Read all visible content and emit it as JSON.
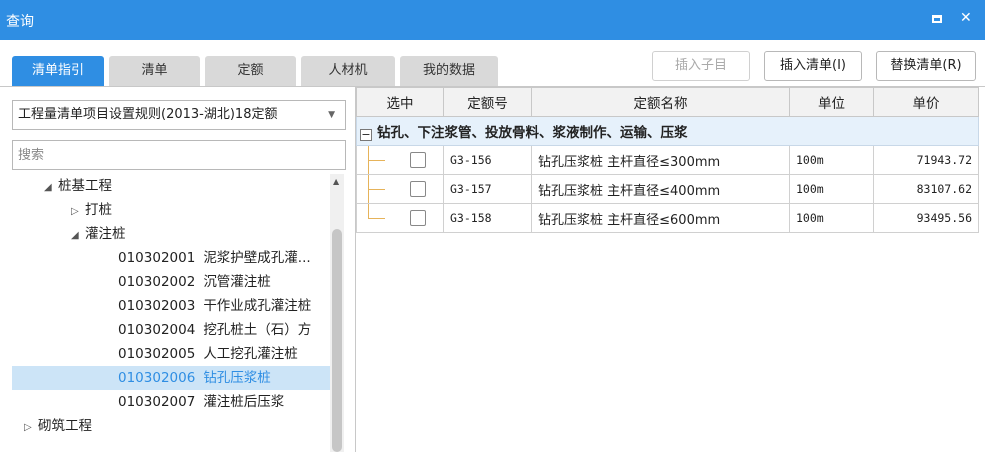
{
  "window": {
    "title": "查询"
  },
  "tabs": [
    {
      "label": "清单指引",
      "active": true
    },
    {
      "label": "清单",
      "active": false
    },
    {
      "label": "定额",
      "active": false
    },
    {
      "label": "人材机",
      "active": false
    },
    {
      "label": "我的数据",
      "active": false
    }
  ],
  "toolbar": {
    "insert_child": "插入子目",
    "insert_list": "插入清单(I)",
    "replace_list": "替换清单(R)"
  },
  "library": {
    "selected": "工程量清单项目设置规则(2013-湖北)18定额"
  },
  "search": {
    "placeholder": "搜索",
    "value": ""
  },
  "tree": [
    {
      "twisty": "◢",
      "code": "",
      "label": "桩基工程"
    },
    {
      "twisty": "▷",
      "code": "",
      "label": "打桩"
    },
    {
      "twisty": "◢",
      "code": "",
      "label": "灌注桩"
    },
    {
      "twisty": "",
      "code": "010302001",
      "label": "泥浆护壁成孔灌..."
    },
    {
      "twisty": "",
      "code": "010302002",
      "label": "沉管灌注桩"
    },
    {
      "twisty": "",
      "code": "010302003",
      "label": "干作业成孔灌注桩"
    },
    {
      "twisty": "",
      "code": "010302004",
      "label": "挖孔桩土（石）方"
    },
    {
      "twisty": "",
      "code": "010302005",
      "label": "人工挖孔灌注桩"
    },
    {
      "twisty": "",
      "code": "010302006",
      "label": "钻孔压浆桩"
    },
    {
      "twisty": "",
      "code": "010302007",
      "label": "灌注桩后压浆"
    },
    {
      "twisty": "▷",
      "code": "",
      "label": "砌筑工程"
    }
  ],
  "grid": {
    "headers": {
      "select": "选中",
      "code": "定额号",
      "name": "定额名称",
      "unit": "单位",
      "price": "单价"
    },
    "group": {
      "toggle": "−",
      "label": "钻孔、下注浆管、投放骨料、浆液制作、运输、压浆"
    },
    "rows": [
      {
        "code": "G3-156",
        "name": "钻孔压浆桩 主杆直径≤300mm",
        "unit": "100m",
        "price": "71943.72"
      },
      {
        "code": "G3-157",
        "name": "钻孔压浆桩 主杆直径≤400mm",
        "unit": "100m",
        "price": "83107.62"
      },
      {
        "code": "G3-158",
        "name": "钻孔压浆桩 主杆直径≤600mm",
        "unit": "100m",
        "price": "93495.56"
      }
    ]
  },
  "colors": {
    "accent": "#2f8ee3",
    "selected_bg": "#cce4f7",
    "group_bg": "#e6f1fb"
  }
}
